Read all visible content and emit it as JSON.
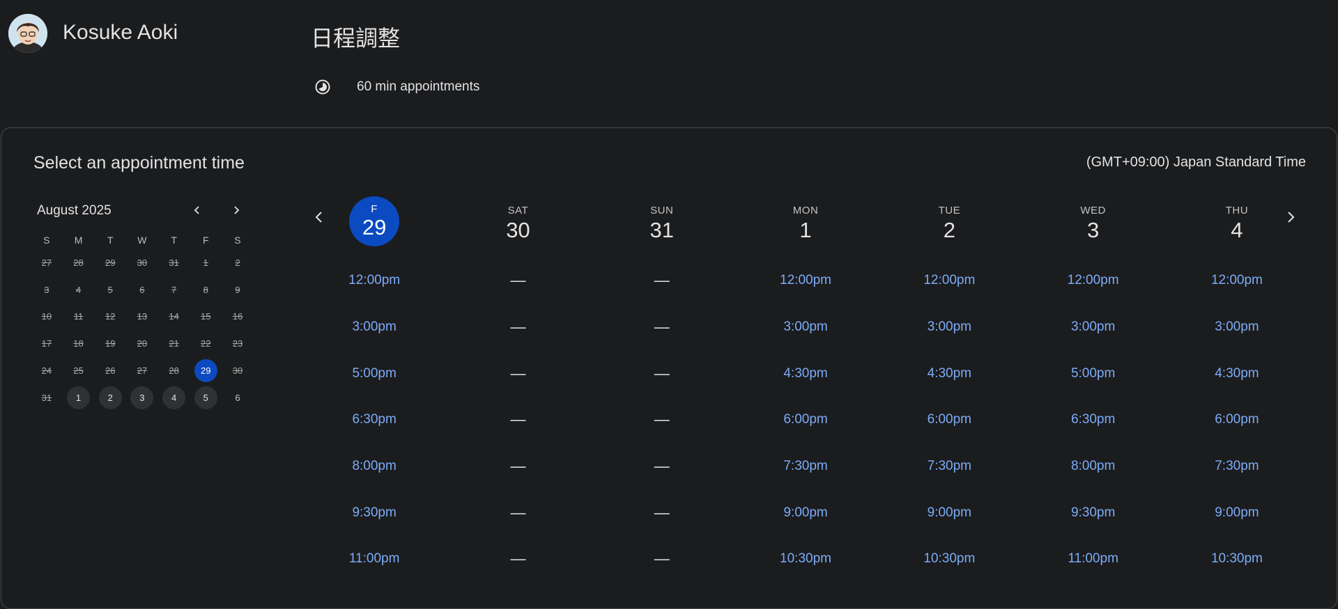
{
  "header": {
    "host_name": "Kosuke Aoki",
    "title": "日程調整",
    "duration": "60 min appointments",
    "avatar_icon": "avatar-portrait",
    "duration_icon": "timer-icon"
  },
  "card": {
    "title": "Select an appointment time",
    "timezone": "(GMT+09:00) Japan Standard Time"
  },
  "mini_calendar": {
    "month": "August 2025",
    "dow": [
      "S",
      "M",
      "T",
      "W",
      "T",
      "F",
      "S"
    ],
    "weeks": [
      [
        {
          "d": "27",
          "s": "past"
        },
        {
          "d": "28",
          "s": "past"
        },
        {
          "d": "29",
          "s": "past"
        },
        {
          "d": "30",
          "s": "past"
        },
        {
          "d": "31",
          "s": "past"
        },
        {
          "d": "1",
          "s": "past"
        },
        {
          "d": "2",
          "s": "past"
        }
      ],
      [
        {
          "d": "3",
          "s": "past"
        },
        {
          "d": "4",
          "s": "past"
        },
        {
          "d": "5",
          "s": "past"
        },
        {
          "d": "6",
          "s": "past"
        },
        {
          "d": "7",
          "s": "past"
        },
        {
          "d": "8",
          "s": "past"
        },
        {
          "d": "9",
          "s": "past"
        }
      ],
      [
        {
          "d": "10",
          "s": "past"
        },
        {
          "d": "11",
          "s": "past"
        },
        {
          "d": "12",
          "s": "past"
        },
        {
          "d": "13",
          "s": "past"
        },
        {
          "d": "14",
          "s": "past"
        },
        {
          "d": "15",
          "s": "past"
        },
        {
          "d": "16",
          "s": "past"
        }
      ],
      [
        {
          "d": "17",
          "s": "past"
        },
        {
          "d": "18",
          "s": "past"
        },
        {
          "d": "19",
          "s": "past"
        },
        {
          "d": "20",
          "s": "past"
        },
        {
          "d": "21",
          "s": "past"
        },
        {
          "d": "22",
          "s": "past"
        },
        {
          "d": "23",
          "s": "past"
        }
      ],
      [
        {
          "d": "24",
          "s": "past"
        },
        {
          "d": "25",
          "s": "past"
        },
        {
          "d": "26",
          "s": "past"
        },
        {
          "d": "27",
          "s": "past"
        },
        {
          "d": "28",
          "s": "past"
        },
        {
          "d": "29",
          "s": "selected"
        },
        {
          "d": "30",
          "s": "past"
        }
      ],
      [
        {
          "d": "31",
          "s": "past"
        },
        {
          "d": "1",
          "s": "avail"
        },
        {
          "d": "2",
          "s": "avail"
        },
        {
          "d": "3",
          "s": "avail"
        },
        {
          "d": "4",
          "s": "avail"
        },
        {
          "d": "5",
          "s": "avail"
        },
        {
          "d": "6",
          "s": "plain"
        }
      ]
    ]
  },
  "week": {
    "days": [
      {
        "abbr": "F",
        "num": "29",
        "selected": true,
        "slots": [
          "12:00pm",
          "3:00pm",
          "5:00pm",
          "6:30pm",
          "8:00pm",
          "9:30pm",
          "11:00pm"
        ]
      },
      {
        "abbr": "SAT",
        "num": "30",
        "selected": false,
        "slots": [
          "—",
          "—",
          "—",
          "—",
          "—",
          "—",
          "—"
        ]
      },
      {
        "abbr": "SUN",
        "num": "31",
        "selected": false,
        "slots": [
          "—",
          "—",
          "—",
          "—",
          "—",
          "—",
          "—"
        ]
      },
      {
        "abbr": "MON",
        "num": "1",
        "selected": false,
        "slots": [
          "12:00pm",
          "3:00pm",
          "4:30pm",
          "6:00pm",
          "7:30pm",
          "9:00pm",
          "10:30pm"
        ]
      },
      {
        "abbr": "TUE",
        "num": "2",
        "selected": false,
        "slots": [
          "12:00pm",
          "3:00pm",
          "4:30pm",
          "6:00pm",
          "7:30pm",
          "9:00pm",
          "10:30pm"
        ]
      },
      {
        "abbr": "WED",
        "num": "3",
        "selected": false,
        "slots": [
          "12:00pm",
          "3:00pm",
          "5:00pm",
          "6:30pm",
          "8:00pm",
          "9:30pm",
          "11:00pm"
        ]
      },
      {
        "abbr": "THU",
        "num": "4",
        "selected": false,
        "slots": [
          "12:00pm",
          "3:00pm",
          "4:30pm",
          "6:00pm",
          "7:30pm",
          "9:00pm",
          "10:30pm"
        ]
      }
    ]
  },
  "colors": {
    "background": "#1b1c1e",
    "accent": "#0b4ac0",
    "slot_link": "#7cacf8",
    "text": "#e3e3e3"
  }
}
